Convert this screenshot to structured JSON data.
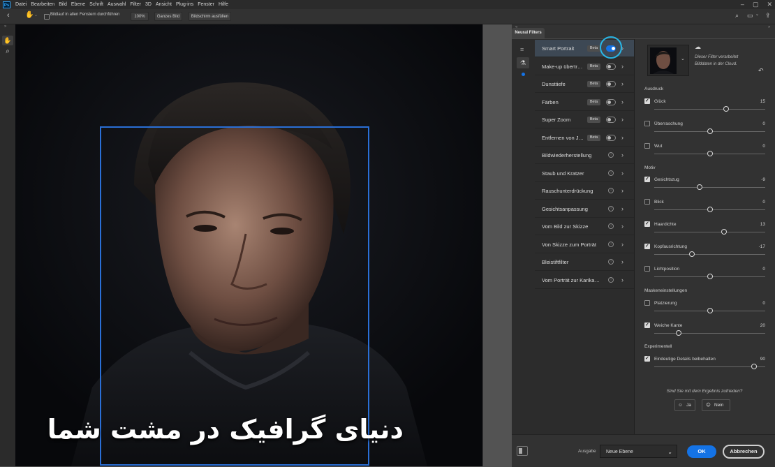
{
  "app": {
    "logo_text": "Ps"
  },
  "menu": [
    "Datei",
    "Bearbeiten",
    "Bild",
    "Ebene",
    "Schrift",
    "Auswahl",
    "Filter",
    "3D",
    "Ansicht",
    "Plug-ins",
    "Fenster",
    "Hilfe"
  ],
  "options_bar": {
    "scroll_all_label": "Bildlauf in allen Fenstern durchführen",
    "zoom_100": "100%",
    "fit_screen": "Ganzes Bild",
    "fill_screen": "Bildschirm ausfüllen"
  },
  "panel": {
    "tab_title": "Neural Filters"
  },
  "filters": [
    {
      "label": "Smart Portrait",
      "badge": "Beta",
      "control": "toggle-on",
      "selected": true
    },
    {
      "label": "Make-up übertr…",
      "badge": "Beta",
      "control": "toggle-off"
    },
    {
      "label": "Dunsttiefe",
      "badge": "Beta",
      "control": "toggle-off"
    },
    {
      "label": "Färben",
      "badge": "Beta",
      "control": "toggle-off"
    },
    {
      "label": "Super Zoom",
      "badge": "Beta",
      "control": "toggle-off"
    },
    {
      "label": "Entfernen von J…",
      "badge": "Beta",
      "control": "toggle-off"
    },
    {
      "label": "Bildwiederherstellung",
      "control": "info"
    },
    {
      "label": "Staub und Kratzer",
      "control": "info"
    },
    {
      "label": "Rauschunterdrückung",
      "control": "info"
    },
    {
      "label": "Gesichtsanpassung",
      "control": "info"
    },
    {
      "label": "Vom Bild zur Skizze",
      "control": "info"
    },
    {
      "label": "Von Skizze zum Porträt",
      "control": "info"
    },
    {
      "label": "Bleistiftfilter",
      "control": "info"
    },
    {
      "label": "Vom Porträt zur Karika…",
      "control": "info"
    }
  ],
  "cloud_note": {
    "line1": "Dieser Filter verarbeitet",
    "line2": "Bilddaten in der Cloud."
  },
  "sections": {
    "ausdruck": "Ausdruck",
    "motiv": "Motiv",
    "maske": "Maskeneinstellungen",
    "experimentell": "Experimentell"
  },
  "sliders": [
    {
      "label": "Glück",
      "value": "15",
      "checked": true,
      "pos": 0.65
    },
    {
      "label": "Überraschung",
      "value": "0",
      "checked": false,
      "pos": 0.5
    },
    {
      "label": "Wut",
      "value": "0",
      "checked": false,
      "pos": 0.5
    },
    {
      "label": "Gesichtszug",
      "value": "-9",
      "checked": true,
      "pos": 0.41
    },
    {
      "label": "Blick",
      "value": "0",
      "checked": false,
      "pos": 0.5
    },
    {
      "label": "Haardichte",
      "value": "13",
      "checked": true,
      "pos": 0.63
    },
    {
      "label": "Kopfausrichtung",
      "value": "-17",
      "checked": true,
      "pos": 0.34
    },
    {
      "label": "Lichtposition",
      "value": "0",
      "checked": false,
      "pos": 0.5
    },
    {
      "label": "Platzierung",
      "value": "0",
      "checked": false,
      "pos": 0.5
    },
    {
      "label": "Weiche Kante",
      "value": "20",
      "checked": true,
      "pos": 0.22
    },
    {
      "label": "Eindeutige Details beibehalten",
      "value": "90",
      "checked": true,
      "pos": 0.9
    }
  ],
  "feedback": {
    "question": "Sind Sie mit dem Ergebnis zufrieden?",
    "yes": "Ja",
    "no": "Nein"
  },
  "bottom": {
    "output_label": "Ausgabe",
    "output_value": "Neue Ebene",
    "ok": "OK",
    "cancel": "Abbrechen"
  },
  "overlay": {
    "text": "دنیای گرافیک در مشت شما"
  },
  "colors": {
    "accent": "#1473e6",
    "highlight_ring": "#29b6e6",
    "face_box": "#2a6fd6"
  }
}
